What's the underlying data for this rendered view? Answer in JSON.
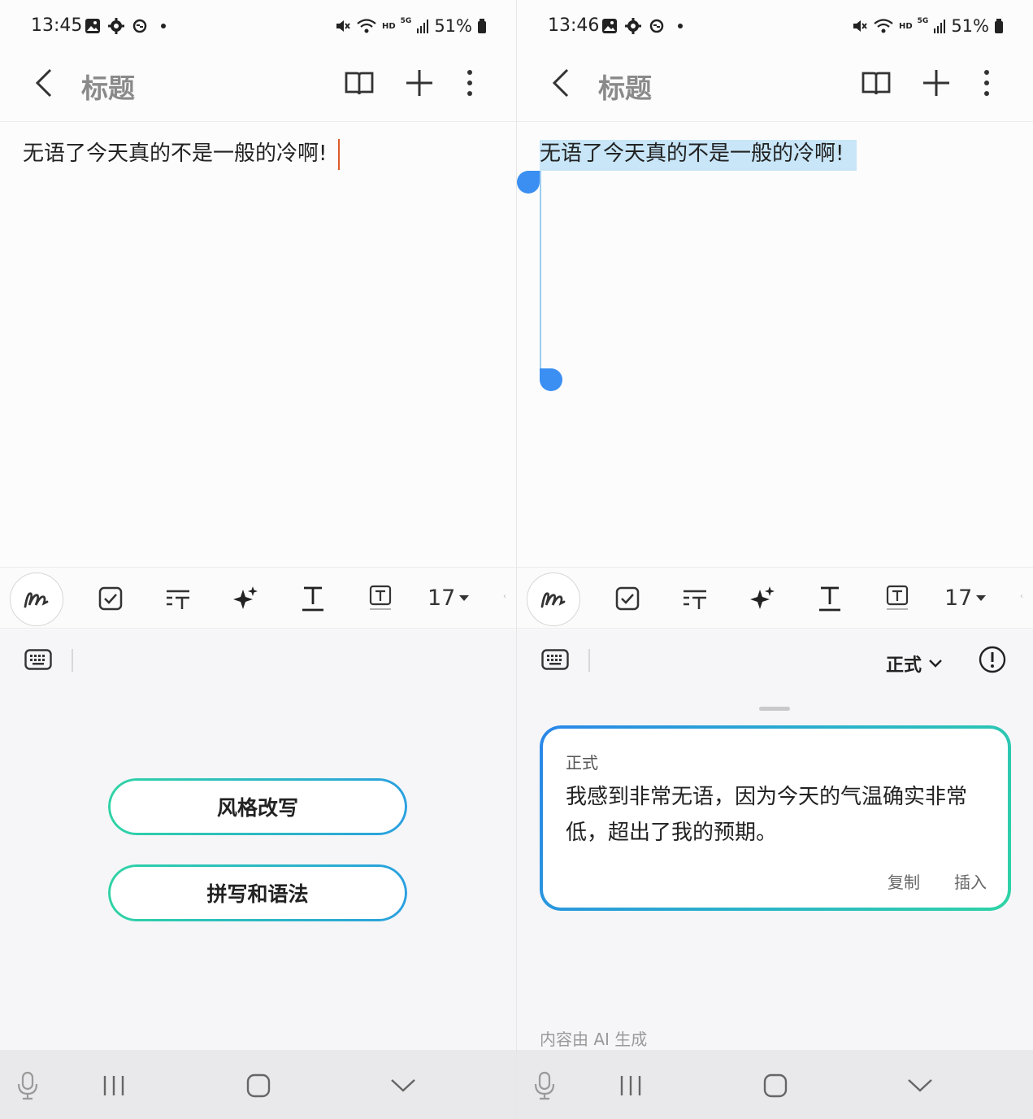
{
  "left": {
    "status": {
      "time": "13:45",
      "battery": "51%",
      "hd": "HD",
      "network": "5G"
    },
    "appbar": {
      "title": "标题"
    },
    "note": {
      "text": "无语了今天真的不是一般的冷啊!"
    },
    "toolbar": {
      "font_size": "17"
    },
    "ai": {
      "buttons": [
        {
          "label": "风格改写"
        },
        {
          "label": "拼写和语法"
        }
      ]
    }
  },
  "right": {
    "status": {
      "time": "13:46",
      "battery": "51%",
      "hd": "HD",
      "network": "5G"
    },
    "appbar": {
      "title": "标题"
    },
    "note": {
      "text": "无语了今天真的不是一般的冷啊!"
    },
    "toolbar": {
      "font_size": "17"
    },
    "ai": {
      "style_selector": "正式",
      "card": {
        "label": "正式",
        "text": "我感到非常无语，因为今天的气温确实非常低，超出了我的预期。",
        "copy": "复制",
        "insert": "插入"
      },
      "footer_note": "内容由 AI 生成"
    }
  },
  "icons": {
    "status": [
      "gallery-icon",
      "settings-icon",
      "sync-icon",
      "mute-icon",
      "wifi-icon",
      "signal-icon",
      "battery-icon"
    ],
    "appbar": [
      "back-icon",
      "book-icon",
      "plus-icon",
      "more-icon"
    ],
    "toolbar": [
      "pen-icon",
      "checkbox-icon",
      "text-format-icon",
      "ai-sparkle-icon",
      "text-style-icon",
      "text-box-icon"
    ],
    "nav": [
      "mic-icon",
      "recents-icon",
      "home-icon",
      "hide-keyboard-icon"
    ]
  }
}
